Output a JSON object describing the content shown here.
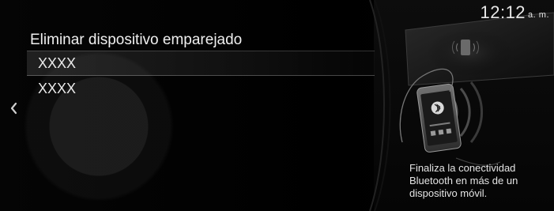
{
  "status": {
    "time": "12:12",
    "ampm": "a. m."
  },
  "screen": {
    "title": "Eliminar dispositivo emparejado",
    "items": [
      {
        "label": "XXXX",
        "selected": true
      },
      {
        "label": "XXXX",
        "selected": false
      }
    ],
    "back_icon": "chevron-left-icon",
    "hint_text": "Finaliza la conectividad\nBluetooth en más de un\ndispositivo móvil."
  }
}
